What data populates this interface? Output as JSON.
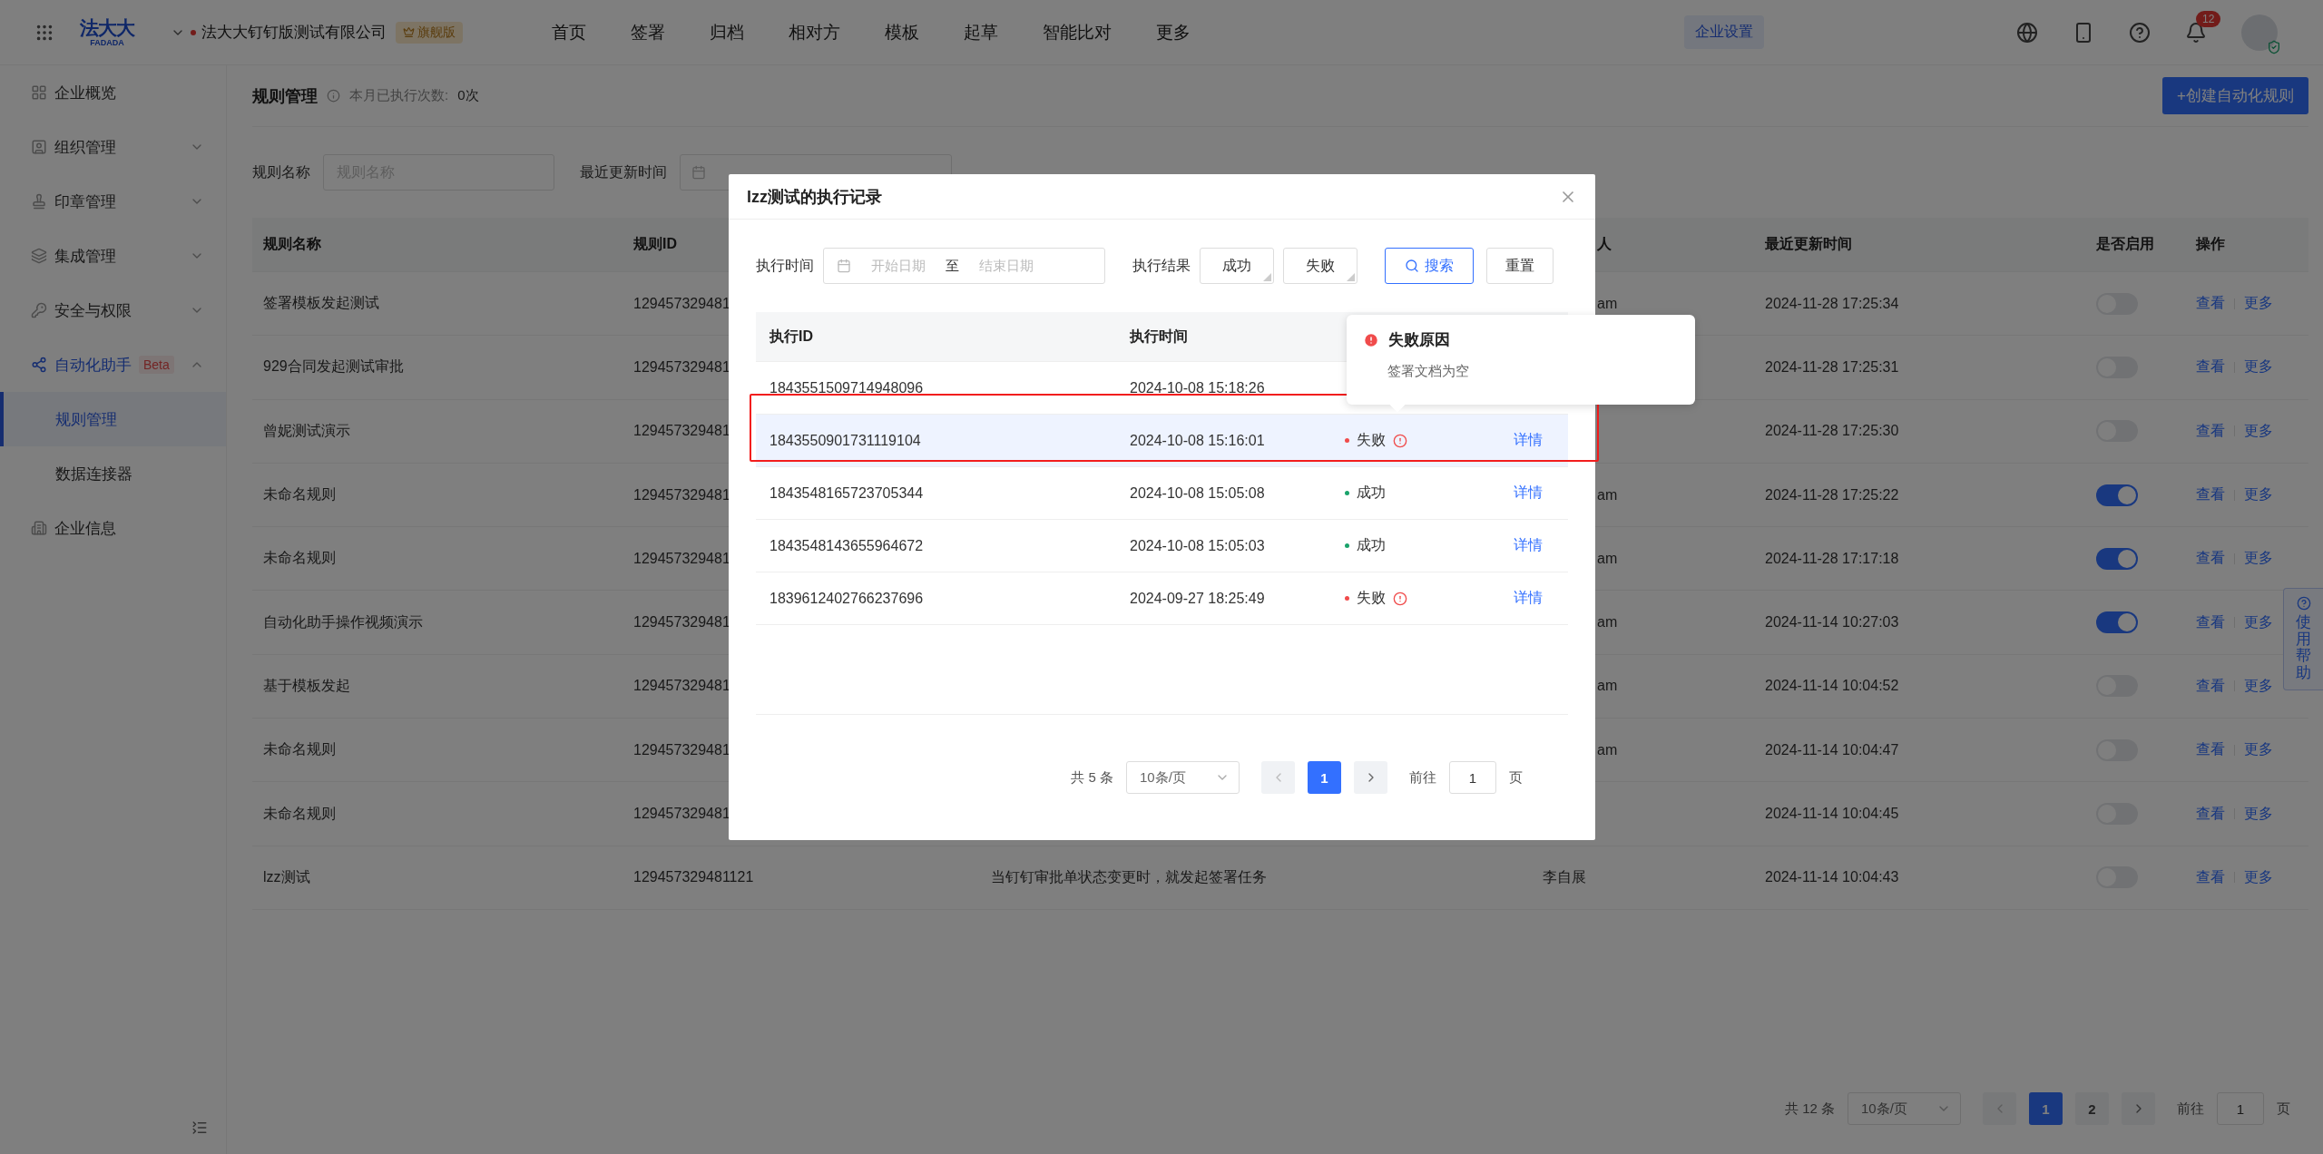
{
  "header": {
    "logo_main": "法大大",
    "logo_sub": "FADADA",
    "company": "法大大钉钉版测试有限公司",
    "edition": "旗舰版",
    "nav": [
      "首页",
      "签署",
      "归档",
      "相对方",
      "模板",
      "起草",
      "智能比对",
      "更多"
    ],
    "settings_button": "企业设置",
    "notification_count": "12"
  },
  "sidebar": {
    "items": [
      {
        "label": "企业概览",
        "selected": false
      },
      {
        "label": "组织管理",
        "selected": false,
        "expanded": false
      },
      {
        "label": "印章管理",
        "selected": false,
        "expanded": false
      },
      {
        "label": "集成管理",
        "selected": false,
        "expanded": false
      },
      {
        "label": "安全与权限",
        "selected": false,
        "expanded": false
      },
      {
        "label": "自动化助手",
        "selected": false,
        "expanded": true,
        "badge": "Beta",
        "children": [
          {
            "label": "规则管理",
            "selected": true
          },
          {
            "label": "数据连接器",
            "selected": false
          }
        ]
      },
      {
        "label": "企业信息",
        "selected": false
      }
    ]
  },
  "page": {
    "title": "规则管理",
    "monthly_label": "本月已执行次数:",
    "monthly_value": "0次",
    "create_button": "+创建自动化规则"
  },
  "filters": {
    "name_label": "规则名称",
    "name_placeholder": "规则名称",
    "time_label": "最近更新时间"
  },
  "table": {
    "columns": {
      "name": "规则名称",
      "id": "规则ID",
      "creator": "人",
      "updated": "最近更新时间",
      "enabled": "是否启用",
      "actions": "操作"
    },
    "rows": [
      {
        "name": "签署模板发起测试",
        "id": "129457329481",
        "creator": "am",
        "updated": "2024-11-28 17:25:34",
        "enabled": false,
        "actions": [
          "查看",
          "更多"
        ]
      },
      {
        "name": "929合同发起测试审批",
        "id": "129457329481",
        "updated": "2024-11-28 17:25:31",
        "enabled": false,
        "actions": [
          "查看",
          "更多"
        ]
      },
      {
        "name": "曾妮测试演示",
        "id": "129457329481",
        "updated": "2024-11-28 17:25:30",
        "enabled": false,
        "actions": [
          "查看",
          "更多"
        ]
      },
      {
        "name": "未命名规则",
        "id": "129457329481",
        "creator": "am",
        "updated": "2024-11-28 17:25:22",
        "enabled": true,
        "actions": [
          "查看",
          "更多"
        ]
      },
      {
        "name": "未命名规则",
        "id": "129457329481",
        "creator": "am",
        "updated": "2024-11-28 17:17:18",
        "enabled": true,
        "actions": [
          "查看",
          "更多"
        ]
      },
      {
        "name": "自动化助手操作视频演示",
        "id": "129457329481",
        "creator": "am",
        "updated": "2024-11-14 10:27:03",
        "enabled": true,
        "actions": [
          "查看",
          "更多"
        ]
      },
      {
        "name": "基于模板发起",
        "id": "129457329481",
        "creator": "am",
        "updated": "2024-11-14 10:04:52",
        "enabled": false,
        "actions": [
          "查看",
          "更多"
        ]
      },
      {
        "name": "未命名规则",
        "id": "129457329481",
        "creator": "am",
        "updated": "2024-11-14 10:04:47",
        "enabled": false,
        "actions": [
          "查看",
          "更多"
        ]
      },
      {
        "name": "未命名规则",
        "id": "129457329481",
        "updated": "2024-11-14 10:04:45",
        "enabled": false,
        "actions": [
          "查看",
          "更多"
        ]
      },
      {
        "name": "lzz测试",
        "id": "129457329481121",
        "description": "当钉钉审批单状态变更时，就发起签署任务",
        "creator": "李自展",
        "updated": "2024-11-14 10:04:43",
        "enabled": false,
        "actions": [
          "查看",
          "更多"
        ]
      }
    ]
  },
  "pagination": {
    "total": "共 12 条",
    "page_size": "10条/页",
    "pages": [
      {
        "label": "1",
        "selected": true
      },
      {
        "label": "2",
        "selected": false
      }
    ],
    "goto_label": "前往",
    "goto_value": "1",
    "page_unit": "页"
  },
  "help": {
    "label": "使用帮助"
  },
  "modal": {
    "title": "lzz测试的执行记录",
    "filters": {
      "time_label": "执行时间",
      "start_placeholder": "开始日期",
      "separator": "至",
      "end_placeholder": "结束日期",
      "result_label": "执行结果",
      "result_options": [
        {
          "label": "成功",
          "selected": false
        },
        {
          "label": "失败",
          "selected": false
        }
      ],
      "search_button": "搜索",
      "reset_button": "重置"
    },
    "columns": {
      "id": "执行ID",
      "time": "执行时间"
    },
    "rows": [
      {
        "id": "1843551509714948096",
        "time": "2024-10-08 15:18:26",
        "selected": false
      },
      {
        "id": "1843550901731119104",
        "time": "2024-10-08 15:16:01",
        "status": {
          "kind": "fail",
          "label": "失败"
        },
        "action": "详情",
        "selected": true
      },
      {
        "id": "1843548165723705344",
        "time": "2024-10-08 15:05:08",
        "status": {
          "kind": "success",
          "label": "成功"
        },
        "action": "详情",
        "selected": false
      },
      {
        "id": "1843548143655964672",
        "time": "2024-10-08 15:05:03",
        "status": {
          "kind": "success",
          "label": "成功"
        },
        "action": "详情",
        "selected": false
      },
      {
        "id": "1839612402766237696",
        "time": "2024-09-27 18:25:49",
        "status": {
          "kind": "fail",
          "label": "失败"
        },
        "action": "详情",
        "selected": false
      }
    ],
    "pagination": {
      "total": "共 5 条",
      "page_size": "10条/页",
      "pages": [
        {
          "label": "1",
          "selected": true
        }
      ],
      "goto_label": "前往",
      "goto_value": "1",
      "page_unit": "页"
    }
  },
  "tooltip": {
    "title": "失败原因",
    "message": "签署文档为空"
  }
}
